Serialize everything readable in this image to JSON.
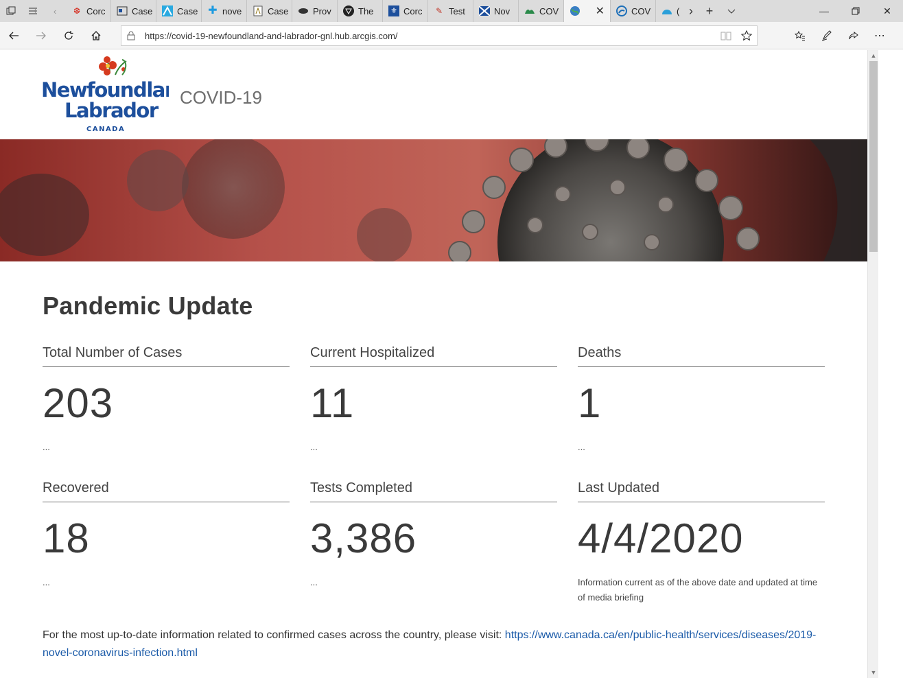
{
  "browser": {
    "tabs": [
      {
        "label": "Corc",
        "icon": "maple-leaf-icon"
      },
      {
        "label": "Case",
        "icon": "news-icon"
      },
      {
        "label": "Case",
        "icon": "chart-icon"
      },
      {
        "label": "nove",
        "icon": "cross-icon"
      },
      {
        "label": "Case",
        "icon": "document-icon"
      },
      {
        "label": "Prov",
        "icon": "bison-icon"
      },
      {
        "label": "The",
        "icon": "star-icon"
      },
      {
        "label": "Corc",
        "icon": "fleur-de-lis-icon"
      },
      {
        "label": "Test",
        "icon": "pen-icon"
      },
      {
        "label": "Nov",
        "icon": "saltire-icon"
      },
      {
        "label": "COV",
        "icon": "island-icon"
      }
    ],
    "active_tab": {
      "icon": "globe-icon"
    },
    "after_tabs": [
      {
        "label": "COV",
        "icon": "arcgis-icon"
      },
      {
        "label": "(",
        "icon": "partial-icon"
      }
    ],
    "url": "https://covid-19-newfoundland-and-labrador-gnl.hub.arcgis.com/"
  },
  "header": {
    "logo_line1": "Newfoundland",
    "logo_line2": "Labrador",
    "logo_line3": "CANADA",
    "site_title": "COVID-19"
  },
  "main": {
    "title": "Pandemic Update",
    "stats": [
      {
        "label": "Total Number of Cases",
        "value": "203",
        "note": "..."
      },
      {
        "label": "Current Hospitalized",
        "value": "11",
        "note": "..."
      },
      {
        "label": "Deaths",
        "value": "1",
        "note": "..."
      },
      {
        "label": "Recovered",
        "value": "18",
        "note": "..."
      },
      {
        "label": "Tests Completed",
        "value": "3,386",
        "note": "..."
      },
      {
        "label": "Last Updated",
        "value": "4/4/2020",
        "note": "Information current as of the above date and updated at time of media briefing"
      }
    ],
    "footer_text": "For the most up-to-date information related to confirmed cases across the country, please visit: ",
    "footer_link": "https://www.canada.ca/en/public-health/services/diseases/2019-novel-coronavirus-infection.html"
  },
  "colors": {
    "link": "#1a5aa8",
    "logo_blue": "#1d4f9c",
    "logo_flower": "#d63b1f",
    "tabstrip": "#dcdcdc"
  }
}
